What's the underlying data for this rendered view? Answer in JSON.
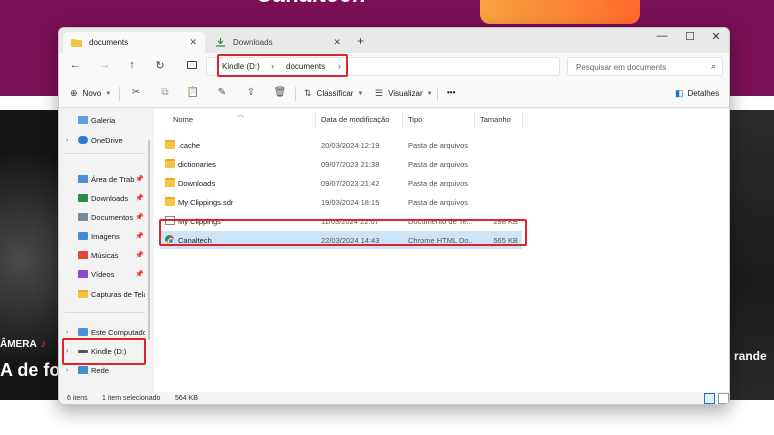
{
  "window": {
    "tabs": [
      {
        "label": "documents",
        "active": true
      },
      {
        "label": "Downloads",
        "active": false
      }
    ],
    "close_tab": "✕",
    "new_tab": "+",
    "controls": {
      "minimize": "—",
      "maximize": "☐",
      "close": "✕"
    }
  },
  "nav": {
    "back": "←",
    "forward": "→",
    "up": "↑",
    "refresh": "↻",
    "breadcrumb": [
      "Kindle (D:)",
      "documents"
    ],
    "separator": "›",
    "search_placeholder": "Pesquisar em documents"
  },
  "toolbar": {
    "new_label": "Novo",
    "sort_label": "Classificar",
    "view_label": "Visualizar",
    "more": "•••",
    "details_label": "Detalhes"
  },
  "sidebar": {
    "items": [
      {
        "label": "Galeria",
        "pinned": false
      },
      {
        "label": "OneDrive",
        "pinned": false
      },
      {
        "label": "Área de Trab",
        "pinned": true
      },
      {
        "label": "Downloads",
        "pinned": true
      },
      {
        "label": "Documentos",
        "pinned": true
      },
      {
        "label": "Imagens",
        "pinned": true
      },
      {
        "label": "Músicas",
        "pinned": true
      },
      {
        "label": "Vídeos",
        "pinned": true
      },
      {
        "label": "Capturas de Tela",
        "pinned": false
      },
      {
        "label": "Este Computador",
        "pinned": false
      },
      {
        "label": "Kindle (D:)",
        "pinned": false
      },
      {
        "label": "Rede",
        "pinned": false
      }
    ]
  },
  "columns": {
    "name": "Nome",
    "date": "Data de modificação",
    "type": "Tipo",
    "size": "Tamanho"
  },
  "files": [
    {
      "name": ".cache",
      "date": "20/03/2024 12:19",
      "type": "Pasta de arquivos",
      "size": "",
      "icon": "folder-icon"
    },
    {
      "name": "dictionaries",
      "date": "09/07/2023 21:38",
      "type": "Pasta de arquivos",
      "size": "",
      "icon": "folder-icon"
    },
    {
      "name": "Downloads",
      "date": "09/07/2023 21:42",
      "type": "Pasta de arquivos",
      "size": "",
      "icon": "folder-icon"
    },
    {
      "name": "My Clippings.sdr",
      "date": "19/03/2024 18:15",
      "type": "Pasta de arquivos",
      "size": "",
      "icon": "folder-icon"
    },
    {
      "name": "My Clippings",
      "date": "11/03/2024 22:07",
      "type": "Documento de Te...",
      "size": "298 KB",
      "icon": "document-icon"
    },
    {
      "name": "Canaltech",
      "date": "22/03/2024 14:43",
      "type": "Chrome HTML Do...",
      "size": "565 KB",
      "icon": "chrome-icon",
      "selected": true
    }
  ],
  "status": {
    "count": "6 itens",
    "selection": "1 item selecionado",
    "selection_size": "564 KB"
  },
  "background": {
    "logo": "Canaltech",
    "camera_text": "ÂMERA",
    "headline_text": "A de fo",
    "right_text": "rande"
  }
}
